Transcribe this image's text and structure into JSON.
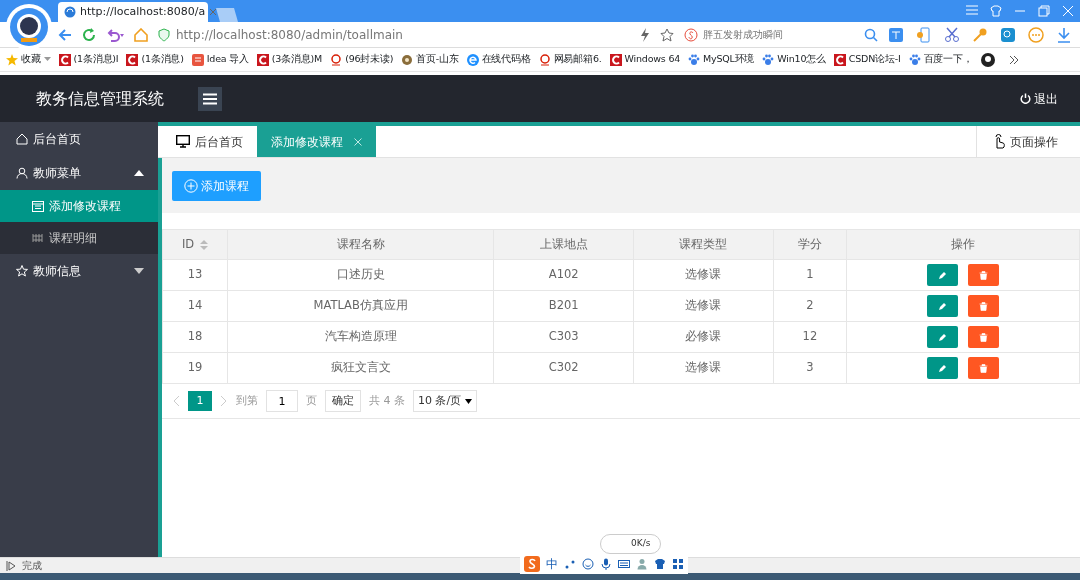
{
  "browser": {
    "tab_title": "http://localhost:8080/a",
    "url": "http://localhost:8080/admin/toallmain",
    "search_placeholder": "胖五发射成功瞬间",
    "bookmarks": [
      {
        "label": "收藏",
        "kind": "star"
      },
      {
        "label": "(1条消息)I",
        "kind": "c"
      },
      {
        "label": "(1条消息)",
        "kind": "c"
      },
      {
        "label": "Idea 导入",
        "kind": "jian"
      },
      {
        "label": "(3条消息)M",
        "kind": "c"
      },
      {
        "label": "(96封未读)",
        "kind": "mail"
      },
      {
        "label": "首页-山东",
        "kind": "globe"
      },
      {
        "label": "在线代码格",
        "kind": "e"
      },
      {
        "label": "网易邮箱6.",
        "kind": "mail"
      },
      {
        "label": "Windows 64",
        "kind": "c"
      },
      {
        "label": "MySQL环境",
        "kind": "paw"
      },
      {
        "label": "Win10怎么",
        "kind": "paw"
      },
      {
        "label": "CSDN论坛-I",
        "kind": "c"
      },
      {
        "label": "百度一下，",
        "kind": "paw"
      }
    ],
    "status": "完成",
    "ime": "中",
    "net_speed": "0K/s"
  },
  "app": {
    "title": "教务信息管理系统",
    "logout": "退出",
    "sidebar": [
      {
        "label": "后台首页"
      },
      {
        "label": "教师菜单",
        "expanded": true,
        "children": [
          {
            "label": "添加修改课程",
            "selected": true
          },
          {
            "label": "课程明细",
            "selected": false
          }
        ]
      },
      {
        "label": "教师信息",
        "expanded": false
      }
    ],
    "tabs": [
      {
        "label": "后台首页",
        "selected": false,
        "closable": false
      },
      {
        "label": "添加修改课程",
        "selected": true,
        "closable": true
      }
    ],
    "page_ops": "页面操作",
    "add_button": "添加课程",
    "table": {
      "columns": [
        "ID",
        "课程名称",
        "上课地点",
        "课程类型",
        "学分",
        "操作"
      ],
      "rows": [
        [
          "13",
          "口述历史",
          "A102",
          "选修课",
          "1"
        ],
        [
          "14",
          "MATLAB仿真应用",
          "B201",
          "选修课",
          "2"
        ],
        [
          "18",
          "汽车构造原理",
          "C303",
          "必修课",
          "12"
        ],
        [
          "19",
          "疯狂文言文",
          "C302",
          "选修课",
          "3"
        ]
      ]
    },
    "pager": {
      "current": "1",
      "goto_label": "到第",
      "goto_value": "1",
      "page_label": "页",
      "confirm": "确定",
      "total": "共 4 条",
      "page_size": "10 条/页"
    }
  }
}
